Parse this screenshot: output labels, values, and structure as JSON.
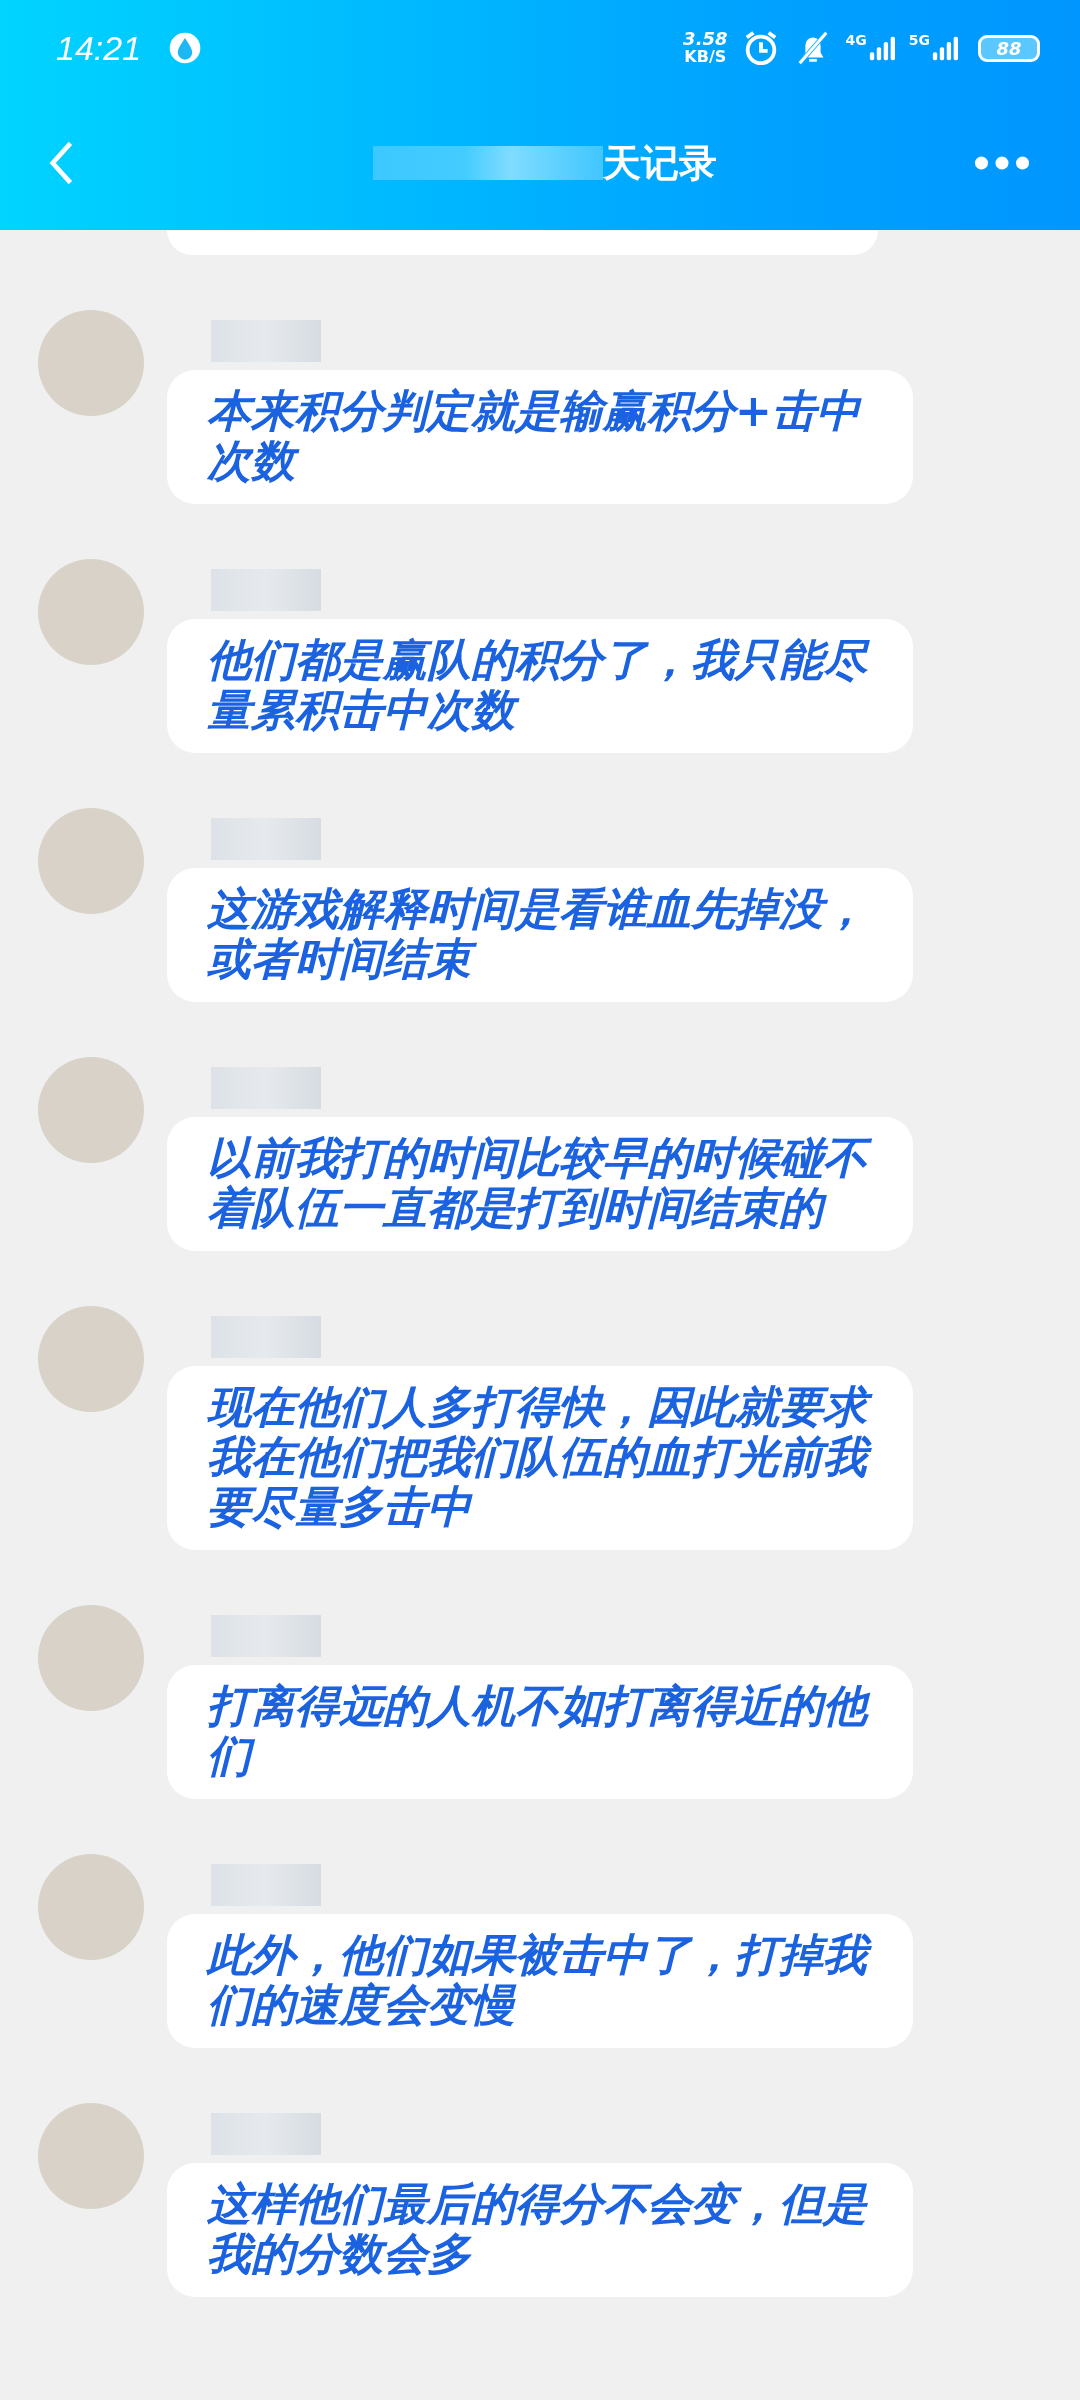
{
  "status_bar": {
    "time": "14:21",
    "speed_value": "3.58",
    "speed_unit": "KB/S",
    "network_1": "4G",
    "network_2": "5G",
    "battery": "88"
  },
  "header": {
    "title": "天记录"
  },
  "messages": [
    {
      "text": "本来积分判定就是输赢积分+击中次数"
    },
    {
      "text": "他们都是赢队的积分了，我只能尽量累积击中次数"
    },
    {
      "text": "这游戏解释时间是看谁血先掉没，或者时间结束"
    },
    {
      "text": "以前我打的时间比较早的时候碰不着队伍一直都是打到时间结束的"
    },
    {
      "text": "现在他们人多打得快，因此就要求我在他们把我们队伍的血打光前我要尽量多击中"
    },
    {
      "text": "打离得远的人机不如打离得近的他们"
    },
    {
      "text": "此外，他们如果被击中了，打掉我们的速度会变慢"
    },
    {
      "text": "这样他们最后的得分不会变，但是我的分数会多"
    }
  ]
}
